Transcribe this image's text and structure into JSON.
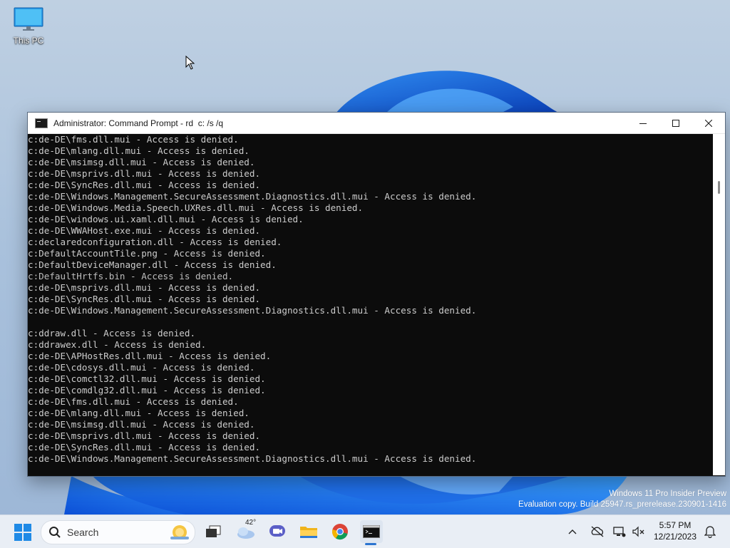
{
  "desktop": {
    "icons": [
      {
        "label": "This PC",
        "icon": "monitor-icon"
      }
    ]
  },
  "cmd_window": {
    "title": "Administrator: Command Prompt - rd  c: /s /q",
    "lines": [
      "c:de-DE\\fms.dll.mui - Access is denied.",
      "c:de-DE\\mlang.dll.mui - Access is denied.",
      "c:de-DE\\msimsg.dll.mui - Access is denied.",
      "c:de-DE\\msprivs.dll.mui - Access is denied.",
      "c:de-DE\\SyncRes.dll.mui - Access is denied.",
      "c:de-DE\\Windows.Management.SecureAssessment.Diagnostics.dll.mui - Access is denied.",
      "c:de-DE\\Windows.Media.Speech.UXRes.dll.mui - Access is denied.",
      "c:de-DE\\windows.ui.xaml.dll.mui - Access is denied.",
      "c:de-DE\\WWAHost.exe.mui - Access is denied.",
      "c:declaredconfiguration.dll - Access is denied.",
      "c:DefaultAccountTile.png - Access is denied.",
      "c:DefaultDeviceManager.dll - Access is denied.",
      "c:DefaultHrtfs.bin - Access is denied.",
      "c:de-DE\\msprivs.dll.mui - Access is denied.",
      "c:de-DE\\SyncRes.dll.mui - Access is denied.",
      "c:de-DE\\Windows.Management.SecureAssessment.Diagnostics.dll.mui - Access is denied.",
      "",
      "c:ddraw.dll - Access is denied.",
      "c:ddrawex.dll - Access is denied.",
      "c:de-DE\\APHostRes.dll.mui - Access is denied.",
      "c:de-DE\\cdosys.dll.mui - Access is denied.",
      "c:de-DE\\comctl32.dll.mui - Access is denied.",
      "c:de-DE\\comdlg32.dll.mui - Access is denied.",
      "c:de-DE\\fms.dll.mui - Access is denied.",
      "c:de-DE\\mlang.dll.mui - Access is denied.",
      "c:de-DE\\msimsg.dll.mui - Access is denied.",
      "c:de-DE\\msprivs.dll.mui - Access is denied.",
      "c:de-DE\\SyncRes.dll.mui - Access is denied.",
      "c:de-DE\\Windows.Management.SecureAssessment.Diagnostics.dll.mui - Access is denied."
    ]
  },
  "watermark": {
    "line1": "Windows 11 Pro Insider Preview",
    "line2": "Evaluation copy. Build 25947.rs_prerelease.230901-1416"
  },
  "taskbar": {
    "search_placeholder": "Search",
    "weather_temp": "42°",
    "apps": [
      "task-view-icon",
      "weather-icon",
      "meet-icon",
      "file-explorer-icon",
      "chrome-icon",
      "command-prompt-icon"
    ],
    "clock": {
      "time": "5:57 PM",
      "date": "12/21/2023"
    }
  },
  "colors": {
    "console_bg": "#0c0c0c",
    "console_fg": "#cccccc",
    "accent": "#2b74d0"
  }
}
